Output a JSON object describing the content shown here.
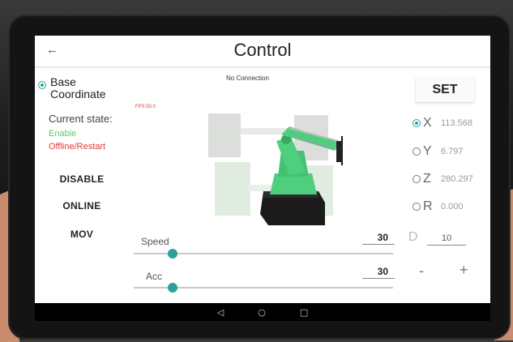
{
  "app": {
    "title": "Control",
    "back_icon": "arrow-left-icon"
  },
  "coordinate": {
    "label_line1": "Base",
    "label_line2": "Coordinate",
    "selected": true
  },
  "state": {
    "label": "Current state:",
    "enable": "Enable",
    "offline": "Offline/Restart"
  },
  "buttons": {
    "disable": "DISABLE",
    "online": "ONLINE",
    "mov": "MOV",
    "set": "SET",
    "minus": "-",
    "plus": "+"
  },
  "viewer": {
    "fps": "FPS:50.0",
    "connection": "No Connection"
  },
  "axes": [
    {
      "label": "X",
      "value": "113.568",
      "selected": true
    },
    {
      "label": "Y",
      "value": "6.797",
      "selected": false
    },
    {
      "label": "Z",
      "value": "280.297",
      "selected": false
    },
    {
      "label": "R",
      "value": "0.000",
      "selected": false
    }
  ],
  "step": {
    "label": "D",
    "value": "10"
  },
  "sliders": {
    "speed": {
      "label": "Speed",
      "value": "30",
      "fraction": 0.15
    },
    "acc": {
      "label": "Acc",
      "value": "30",
      "fraction": 0.15
    }
  },
  "navbar": {
    "back": "◁",
    "home": "○",
    "recents": "□"
  },
  "colors": {
    "accent": "#2aa19a",
    "enable": "#5ec86a",
    "offline": "#e23b3b",
    "robot": "#4ecf7e"
  }
}
